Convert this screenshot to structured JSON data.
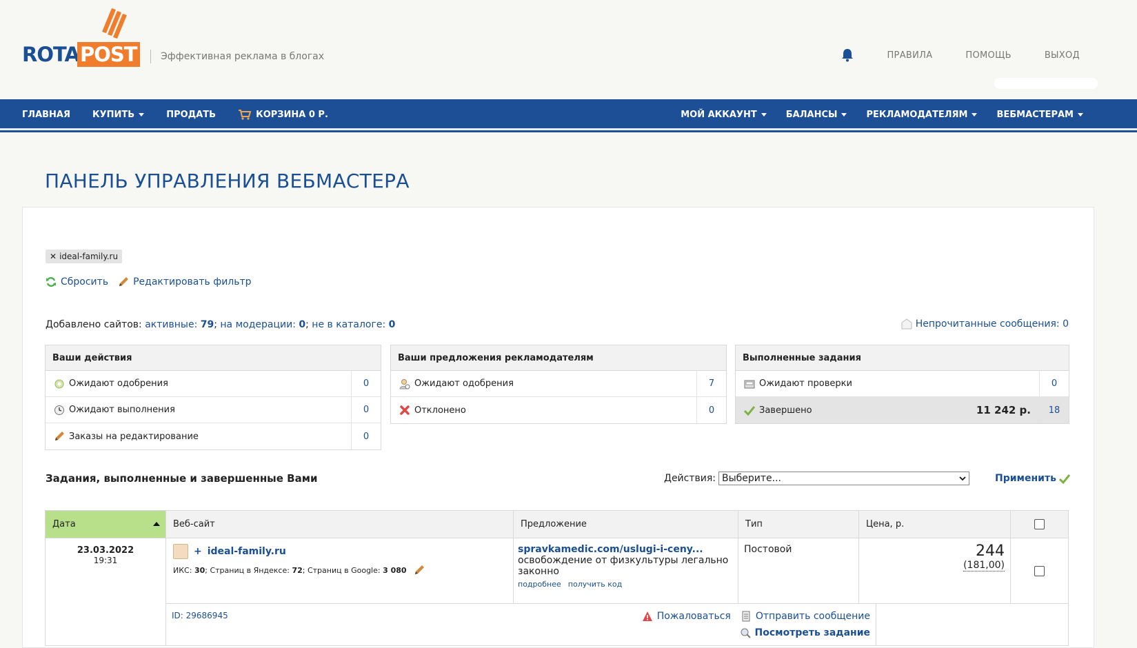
{
  "header": {
    "logo_part1": "ROTA",
    "logo_part2": "POST",
    "tagline": "Эффективная реклама в блогах",
    "links": [
      "ПРАВИЛА",
      "ПОМОЩЬ",
      "ВЫХОД"
    ]
  },
  "nav": {
    "left": [
      {
        "label": "ГЛАВНАЯ",
        "caret": false
      },
      {
        "label": "КУПИТЬ",
        "caret": true
      },
      {
        "label": "ПРОДАТЬ",
        "caret": false
      },
      {
        "label": "КОРЗИНА 0 Р.",
        "caret": false,
        "icon": "cart-icon"
      }
    ],
    "right": [
      {
        "label": "МОЙ АККАУНТ",
        "caret": true
      },
      {
        "label": "БАЛАНСЫ",
        "caret": true
      },
      {
        "label": "РЕКЛАМОДАТЕЛЯМ",
        "caret": true
      },
      {
        "label": "ВЕБМАСТЕРАМ",
        "caret": true
      }
    ]
  },
  "page_title": "ПАНЕЛЬ УПРАВЛЕНИЯ ВЕБМАСТЕРА",
  "filter": {
    "tag": "ideal-family.ru",
    "reset": "Сбросить",
    "edit": "Редактировать фильтр"
  },
  "sites": {
    "prefix": "Добавлено сайтов:",
    "active_label": "активные:",
    "active_count": "79",
    "moderation_label": "на модерации:",
    "moderation_count": "0",
    "not_catalog_label": "не в каталоге:",
    "not_catalog_count": "0",
    "sep": ";"
  },
  "unread": "Непрочитанные сообщения: 0",
  "boxes": {
    "actions": {
      "title": "Ваши действия",
      "rows": [
        {
          "label": "Ожидают одобрения",
          "count": "0"
        },
        {
          "label": "Ожидают выполнения",
          "count": "0"
        },
        {
          "label": "Заказы на редактирование",
          "count": "0"
        }
      ]
    },
    "offers": {
      "title": "Ваши предложения рекламодателям",
      "rows": [
        {
          "label": "Ожидают одобрения",
          "count": "7"
        },
        {
          "label": "Отклонено",
          "count": "0"
        }
      ]
    },
    "done": {
      "title": "Выполненные задания",
      "rows": [
        {
          "label": "Ожидают проверки",
          "count": "0"
        },
        {
          "label": "Завершено",
          "amount": "11 242 р.",
          "count": "18"
        }
      ]
    }
  },
  "tasks": {
    "title": "Задания, выполненные и завершенные Вами",
    "actions_label": "Действия:",
    "actions_selected": "Выберите...",
    "apply": "Применить",
    "columns": [
      "Дата",
      "Веб-сайт",
      "Предложение",
      "Тип",
      "Цена, р."
    ],
    "row": {
      "date": "23.03.2022",
      "time": "19:31",
      "plus": "+",
      "site": "ideal-family.ru",
      "iks_label": "ИКС:",
      "iks": "30",
      "yandex_label": "Страниц в Яндексе:",
      "yandex": "72",
      "google_label": "Страниц в Google:",
      "google": "3 080",
      "offer_link": "spravkamedic.com/uslugi-i-ceny...",
      "offer_text": "освобождение от физкультуры легально законно",
      "more": "подробнее",
      "get_code": "получить код",
      "type": "Постовой",
      "price": "244",
      "price_sub": "(181,00)",
      "id": "ID: 29686945",
      "complain": "Пожаловаться",
      "message": "Отправить сообщение",
      "view": "Посмотреть задание"
    }
  },
  "colors": {
    "brand_blue": "#1c4f95",
    "brand_orange": "#ef7d2b",
    "sort_header": "#b8e08a"
  }
}
